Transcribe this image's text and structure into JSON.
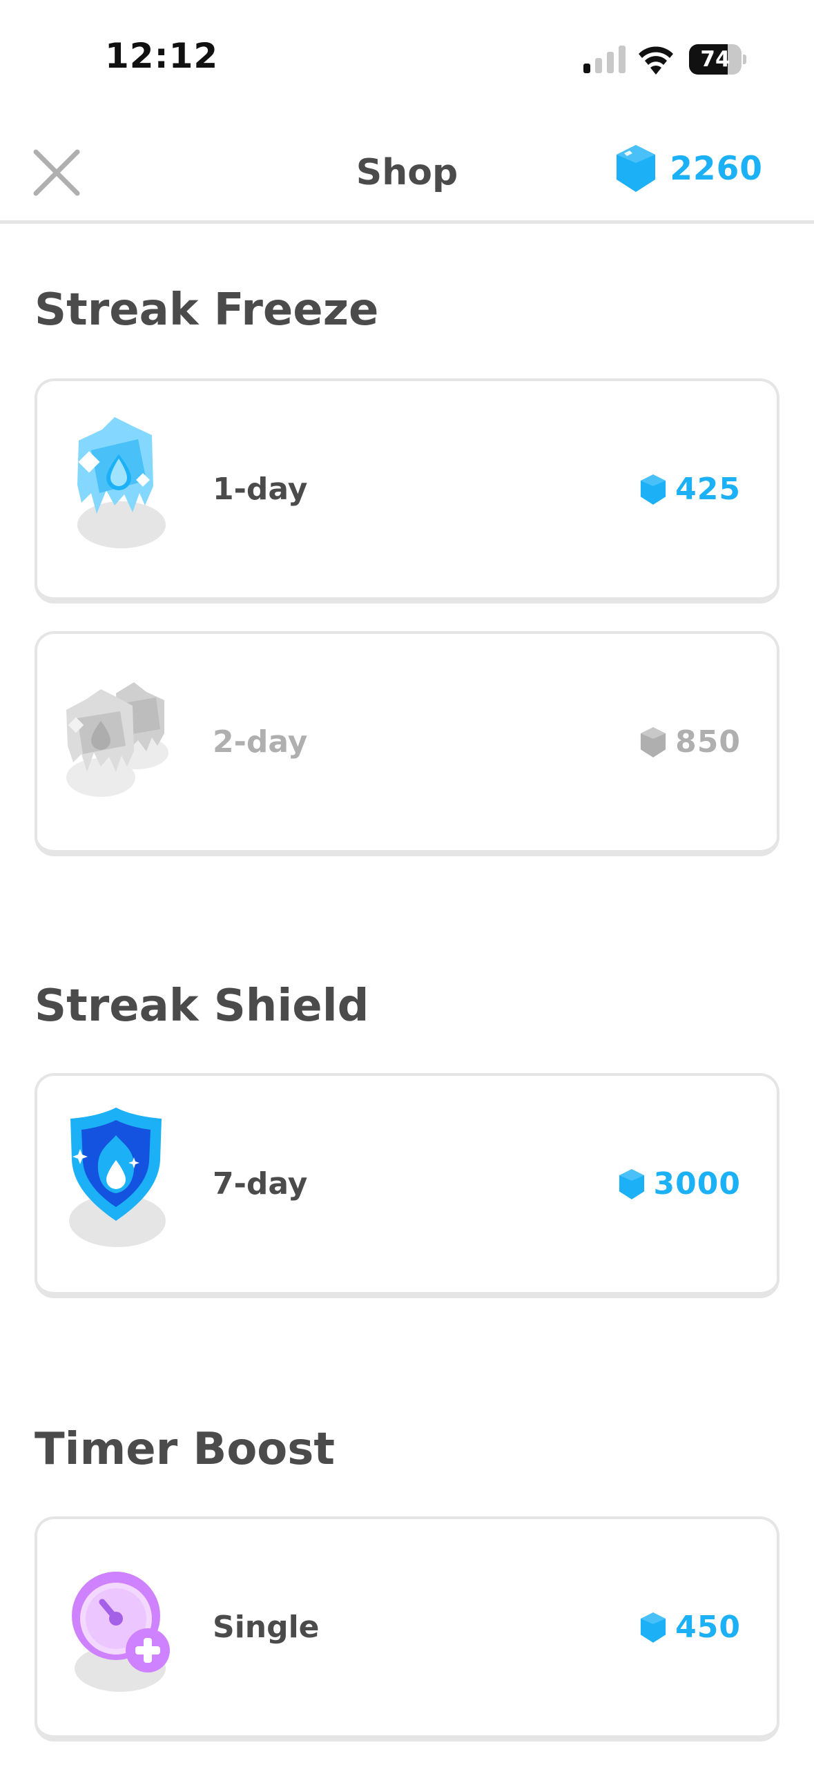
{
  "status_bar": {
    "time": "12:12",
    "battery": "74"
  },
  "header": {
    "title": "Shop",
    "gem_count": "2260"
  },
  "sections": [
    {
      "title": "Streak Freeze",
      "items": [
        {
          "label": "1-day",
          "price": "425",
          "icon": "ice-cube-icon",
          "enabled": true
        },
        {
          "label": "2-day",
          "price": "850",
          "icon": "double-ice-cube-icon",
          "enabled": false
        }
      ]
    },
    {
      "title": "Streak Shield",
      "items": [
        {
          "label": "7-day",
          "price": "3000",
          "icon": "shield-icon",
          "enabled": true
        }
      ]
    },
    {
      "title": "Timer Boost",
      "items": [
        {
          "label": "Single",
          "price": "450",
          "icon": "timer-boost-icon",
          "enabled": true
        }
      ]
    }
  ],
  "colors": {
    "gem_blue": "#1cb0f6",
    "text_dark": "#4b4b4b",
    "disabled_gray": "#afafaf",
    "border_gray": "#e5e5e5"
  }
}
